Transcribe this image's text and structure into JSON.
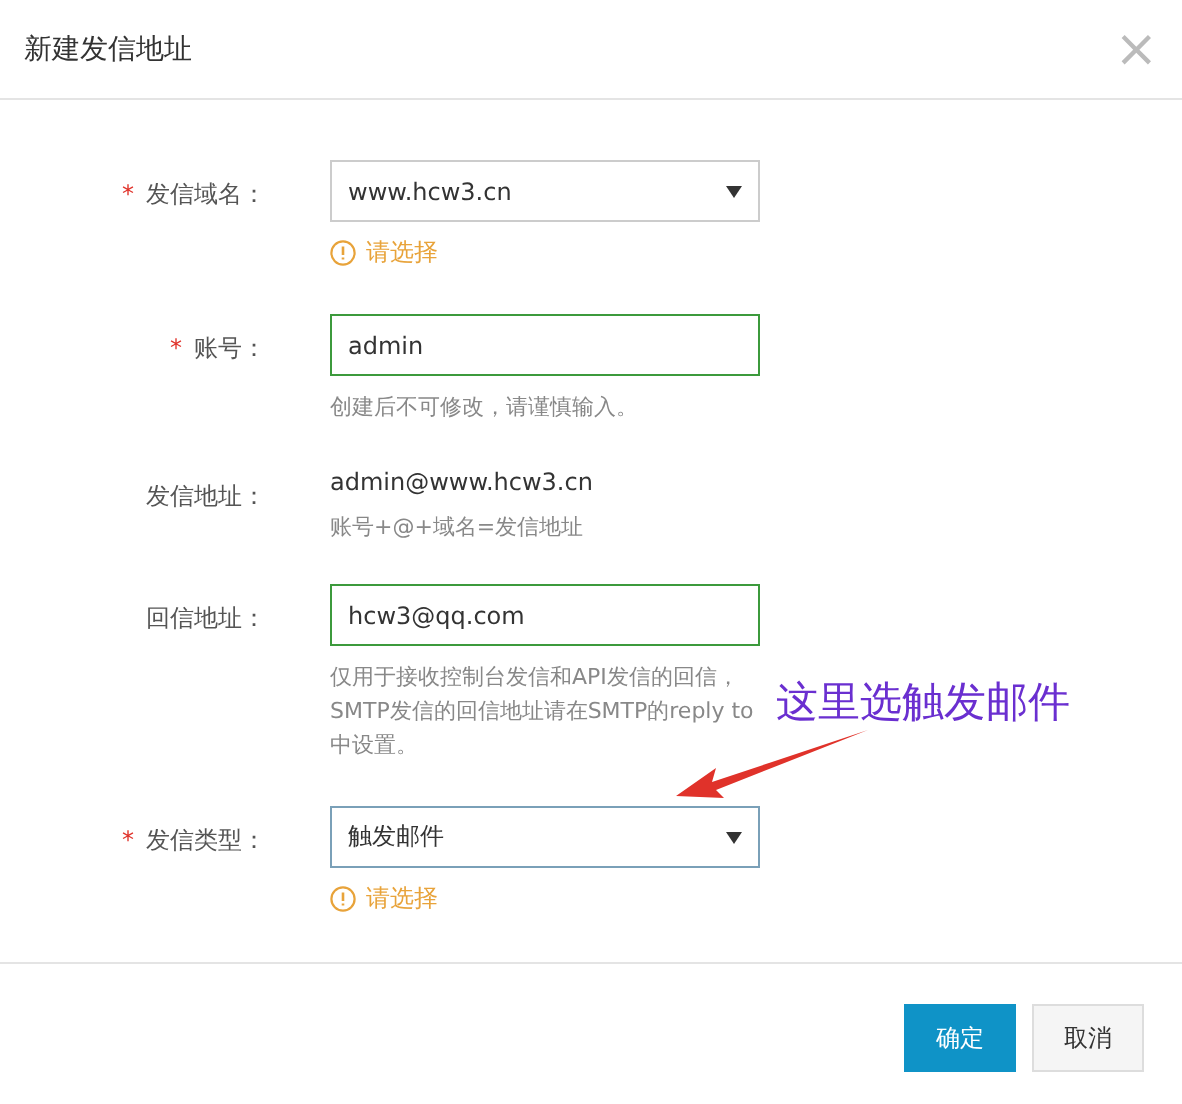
{
  "dialog": {
    "title": "新建发信地址",
    "close": "×"
  },
  "fields": [
    {
      "kind": "select",
      "required_mark": "*",
      "label": "发信域名：",
      "value": "www.hcw3.cn",
      "warning": "请选择",
      "focused": false
    },
    {
      "kind": "input",
      "required_mark": "*",
      "label": "账号：",
      "value": "admin",
      "help": "创建后不可修改，请谨慎输入。",
      "valid": true
    },
    {
      "kind": "text",
      "label": "发信地址：",
      "value": "admin@www.hcw3.cn",
      "help": "账号+@+域名=发信地址"
    },
    {
      "kind": "input",
      "label": "回信地址：",
      "value": "hcw3@qq.com",
      "help": "仅用于接收控制台发信和API发信的回信，SMTP发信的回信地址请在SMTP的reply to中设置。",
      "valid": true
    },
    {
      "kind": "select",
      "required_mark": "*",
      "label": "发信类型：",
      "value": "触发邮件",
      "warning": "请选择",
      "focused": true
    }
  ],
  "annotation": "这里选触发邮件",
  "buttons": [
    {
      "label": "确定",
      "primary": true
    },
    {
      "label": "取消",
      "primary": false
    }
  ]
}
